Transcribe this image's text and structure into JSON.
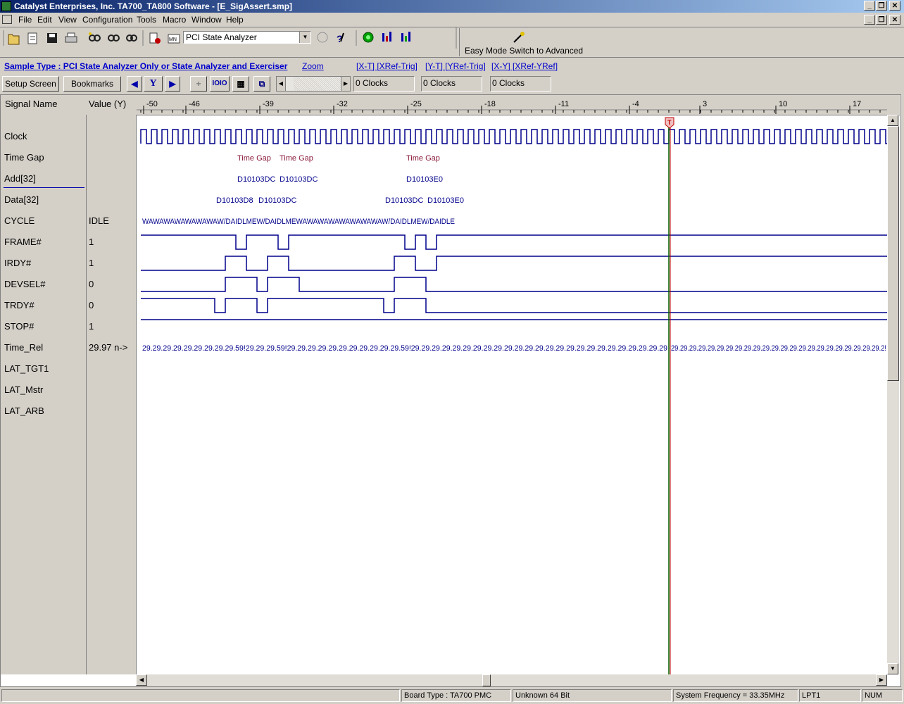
{
  "window": {
    "title": "Catalyst Enterprises, Inc. TA700_TA800 Software - [E_SigAssert.smp]"
  },
  "menu": [
    "File",
    "Edit",
    "View",
    "Configuration",
    "Tools",
    "Macro",
    "Window",
    "Help"
  ],
  "toolbar": {
    "analyzer_select": "PCI State Analyzer",
    "easy_mode_label": "Easy Mode Switch to Advanced"
  },
  "links": {
    "sample_type": "Sample Type : PCI State Analyzer Only or State Analyzer and Exerciser",
    "zoom": "Zoom",
    "xt": "[X-T] [XRef-Trig]",
    "yt": "[Y-T] [YRef-Trig]",
    "xy": "[X-Y] [XRef-YRef]"
  },
  "controls": {
    "setup_screen": "Setup Screen",
    "bookmarks": "Bookmarks",
    "y_button": "Y",
    "hex_button": "IOIO",
    "clocks_x": "0 Clocks",
    "clocks_y": "0 Clocks",
    "clocks_xy": "0 Clocks"
  },
  "columns": {
    "signal_name": "Signal Name",
    "value": "Value (Y)"
  },
  "ruler_ticks": [
    "-50",
    "-46",
    "-39",
    "-32",
    "-25",
    "-18",
    "-11",
    "-4",
    "3",
    "10",
    "17"
  ],
  "signals": [
    {
      "name": "Clock",
      "value": ""
    },
    {
      "name": "Time Gap",
      "value": ""
    },
    {
      "name": "Add[32]",
      "value": ""
    },
    {
      "name": "Data[32]",
      "value": ""
    },
    {
      "name": "CYCLE",
      "value": "IDLE"
    },
    {
      "name": "FRAME#",
      "value": "1"
    },
    {
      "name": "IRDY#",
      "value": "1"
    },
    {
      "name": "DEVSEL#",
      "value": "0"
    },
    {
      "name": "TRDY#",
      "value": "0"
    },
    {
      "name": "STOP#",
      "value": "1"
    },
    {
      "name": "Time_Rel",
      "value": "29.97  n->"
    },
    {
      "name": "LAT_TGT1",
      "value": ""
    },
    {
      "name": "LAT_Mstr",
      "value": ""
    },
    {
      "name": "LAT_ARB",
      "value": ""
    }
  ],
  "waveform": {
    "time_gap_labels": [
      "Time Gap",
      "Time Gap",
      "Time Gap"
    ],
    "add_labels": [
      "D10103DC",
      "D10103DC",
      "D10103E0"
    ],
    "data_labels": [
      "D10103D8",
      "D10103DC",
      "D10103DC",
      "D10103E0"
    ],
    "cycle_text": "WAWAWAWAWAWAWAW/DAIDLMEW/DAIDLMEWAWAWAWAWAWAWAWAW/DAIDLMEW/DAIDLE",
    "time_rel_text_left": "29.29.29.29.29.29.29.29.29.59!29.29.29.59!29.29.29.29.29.29.29.29.29.29.29.59!29.29.29.29.29.29.29.29.29.29.29.29.29.29.29.29.29.29.29.29.29.29.29.29.29",
    "time_rel_text_right": "29.29.29.29.29.29.29.29.29.29.29.29.29.29.29.29.29.29.29.29.29.29.29.2!",
    "trigger_marker": "T"
  },
  "status_bar": {
    "board_type": "Board Type : TA700 PMC",
    "bus": "Unknown 64 Bit",
    "frequency": "System Frequency = 33.35MHz",
    "port": "LPT1",
    "num": "NUM"
  },
  "colors": {
    "title_start": "#0a246a",
    "waveform": "#00008b",
    "time_gap": "#8b1a3a",
    "cursor_green": "#006400",
    "cursor_red": "#c00000"
  }
}
